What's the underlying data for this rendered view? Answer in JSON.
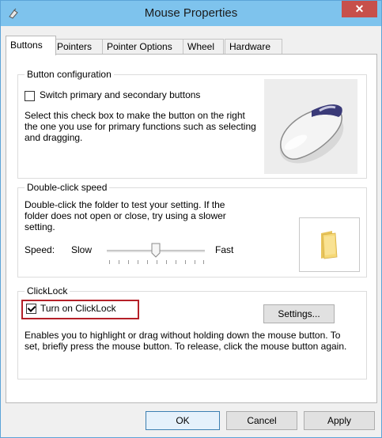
{
  "window": {
    "title": "Mouse Properties",
    "close_symbol": "✕"
  },
  "tabs": [
    {
      "label": "Buttons",
      "active": true
    },
    {
      "label": "Pointers"
    },
    {
      "label": "Pointer Options"
    },
    {
      "label": "Wheel"
    },
    {
      "label": "Hardware"
    }
  ],
  "button_config": {
    "title": "Button configuration",
    "checkbox_label": "Switch primary and secondary buttons",
    "checked": false,
    "description": "Select this check box to make the button on the right the one you use for primary functions such as selecting and dragging."
  },
  "double_click": {
    "title": "Double-click speed",
    "description": "Double-click the folder to test your setting. If the folder does not open or close, try using a slower setting.",
    "speed_label": "Speed:",
    "slow_label": "Slow",
    "fast_label": "Fast",
    "slider_value_fraction": 0.5
  },
  "clicklock": {
    "title": "ClickLock",
    "checkbox_label": "Turn on ClickLock",
    "checked": true,
    "settings_label": "Settings...",
    "description": "Enables you to highlight or drag without holding down the mouse button. To set, briefly press the mouse button. To release, click the mouse button again."
  },
  "footer": {
    "ok_label": "OK",
    "cancel_label": "Cancel",
    "apply_label": "Apply"
  },
  "colors": {
    "titlebar": "#7ec3ed",
    "close": "#c7504b",
    "highlight": "#b52028"
  }
}
